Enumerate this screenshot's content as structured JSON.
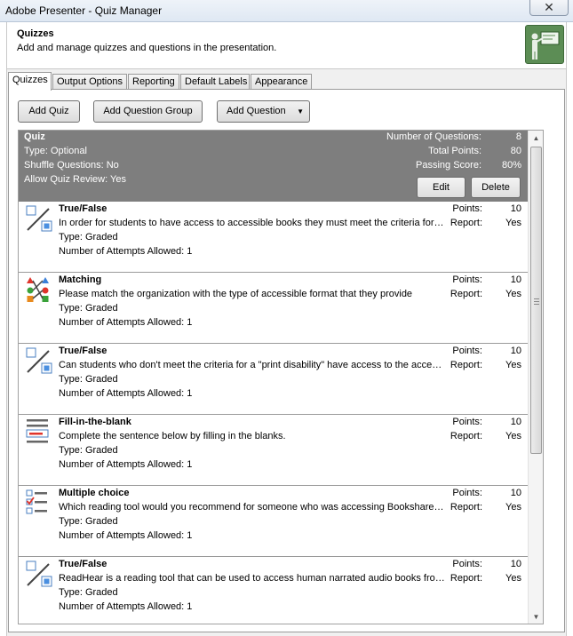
{
  "window": {
    "title": "Adobe Presenter - Quiz Manager",
    "close_glyph": "✕"
  },
  "header": {
    "title": "Quizzes",
    "description": "Add and manage quizzes and questions in the presentation.",
    "icon": "presenter-at-board-icon"
  },
  "tabs": [
    {
      "label": "Quizzes",
      "active": true
    },
    {
      "label": "Output Options",
      "active": false
    },
    {
      "label": "Reporting",
      "active": false
    },
    {
      "label": "Default Labels",
      "active": false
    },
    {
      "label": "Appearance",
      "active": false
    }
  ],
  "toolbar": {
    "add_quiz": "Add Quiz",
    "add_question_group": "Add Question Group",
    "add_question": "Add Question"
  },
  "quiz": {
    "name": "Quiz",
    "type": "Type: Optional",
    "shuffle": "Shuffle Questions: No",
    "review": "Allow Quiz Review: Yes",
    "num_questions_label": "Number of Questions:",
    "num_questions": "8",
    "total_points_label": "Total Points:",
    "total_points": "80",
    "passing_score_label": "Passing Score:",
    "passing_score": "80%",
    "edit": "Edit",
    "delete": "Delete"
  },
  "labels": {
    "points": "Points:",
    "report": "Report:"
  },
  "questions": [
    {
      "icon": "true-false-icon",
      "kind": "True/False",
      "text": "In order for students to have access to accessible books they must meet the criteria for a \"print disability\"",
      "type": "Type: Graded",
      "attempts": "Number of Attempts Allowed: 1",
      "points": "10",
      "report": "Yes"
    },
    {
      "icon": "matching-icon",
      "kind": "Matching",
      "text": "Please match the organization with the type of accessible format that they provide",
      "type": "Type: Graded",
      "attempts": "Number of Attempts Allowed: 1",
      "points": "10",
      "report": "Yes"
    },
    {
      "icon": "true-false-icon",
      "kind": "True/False",
      "text": "Can students who don't meet the criteria for a \"print disability\" have access to the accessible books?",
      "type": "Type: Graded",
      "attempts": "Number of Attempts Allowed: 1",
      "points": "10",
      "report": "Yes"
    },
    {
      "icon": "fill-in-the-blank-icon",
      "kind": "Fill-in-the-blank",
      "text": "Complete the sentence below by filling in the blanks.",
      "type": "Type: Graded",
      "attempts": "Number of Attempts Allowed: 1",
      "points": "10",
      "report": "Yes"
    },
    {
      "icon": "multiple-choice-icon",
      "kind": "Multiple choice",
      "text": "Which reading tool would you recommend for someone who was accessing Bookshare with a screen reader?",
      "type": "Type: Graded",
      "attempts": "Number of Attempts Allowed: 1",
      "points": "10",
      "report": "Yes"
    },
    {
      "icon": "true-false-icon",
      "kind": "True/False",
      "text": "ReadHear is a reading tool that can be used to access human narrated audio books from Learning Ally",
      "type": "Type: Graded",
      "attempts": "Number of Attempts Allowed: 1",
      "points": "10",
      "report": "Yes"
    }
  ]
}
